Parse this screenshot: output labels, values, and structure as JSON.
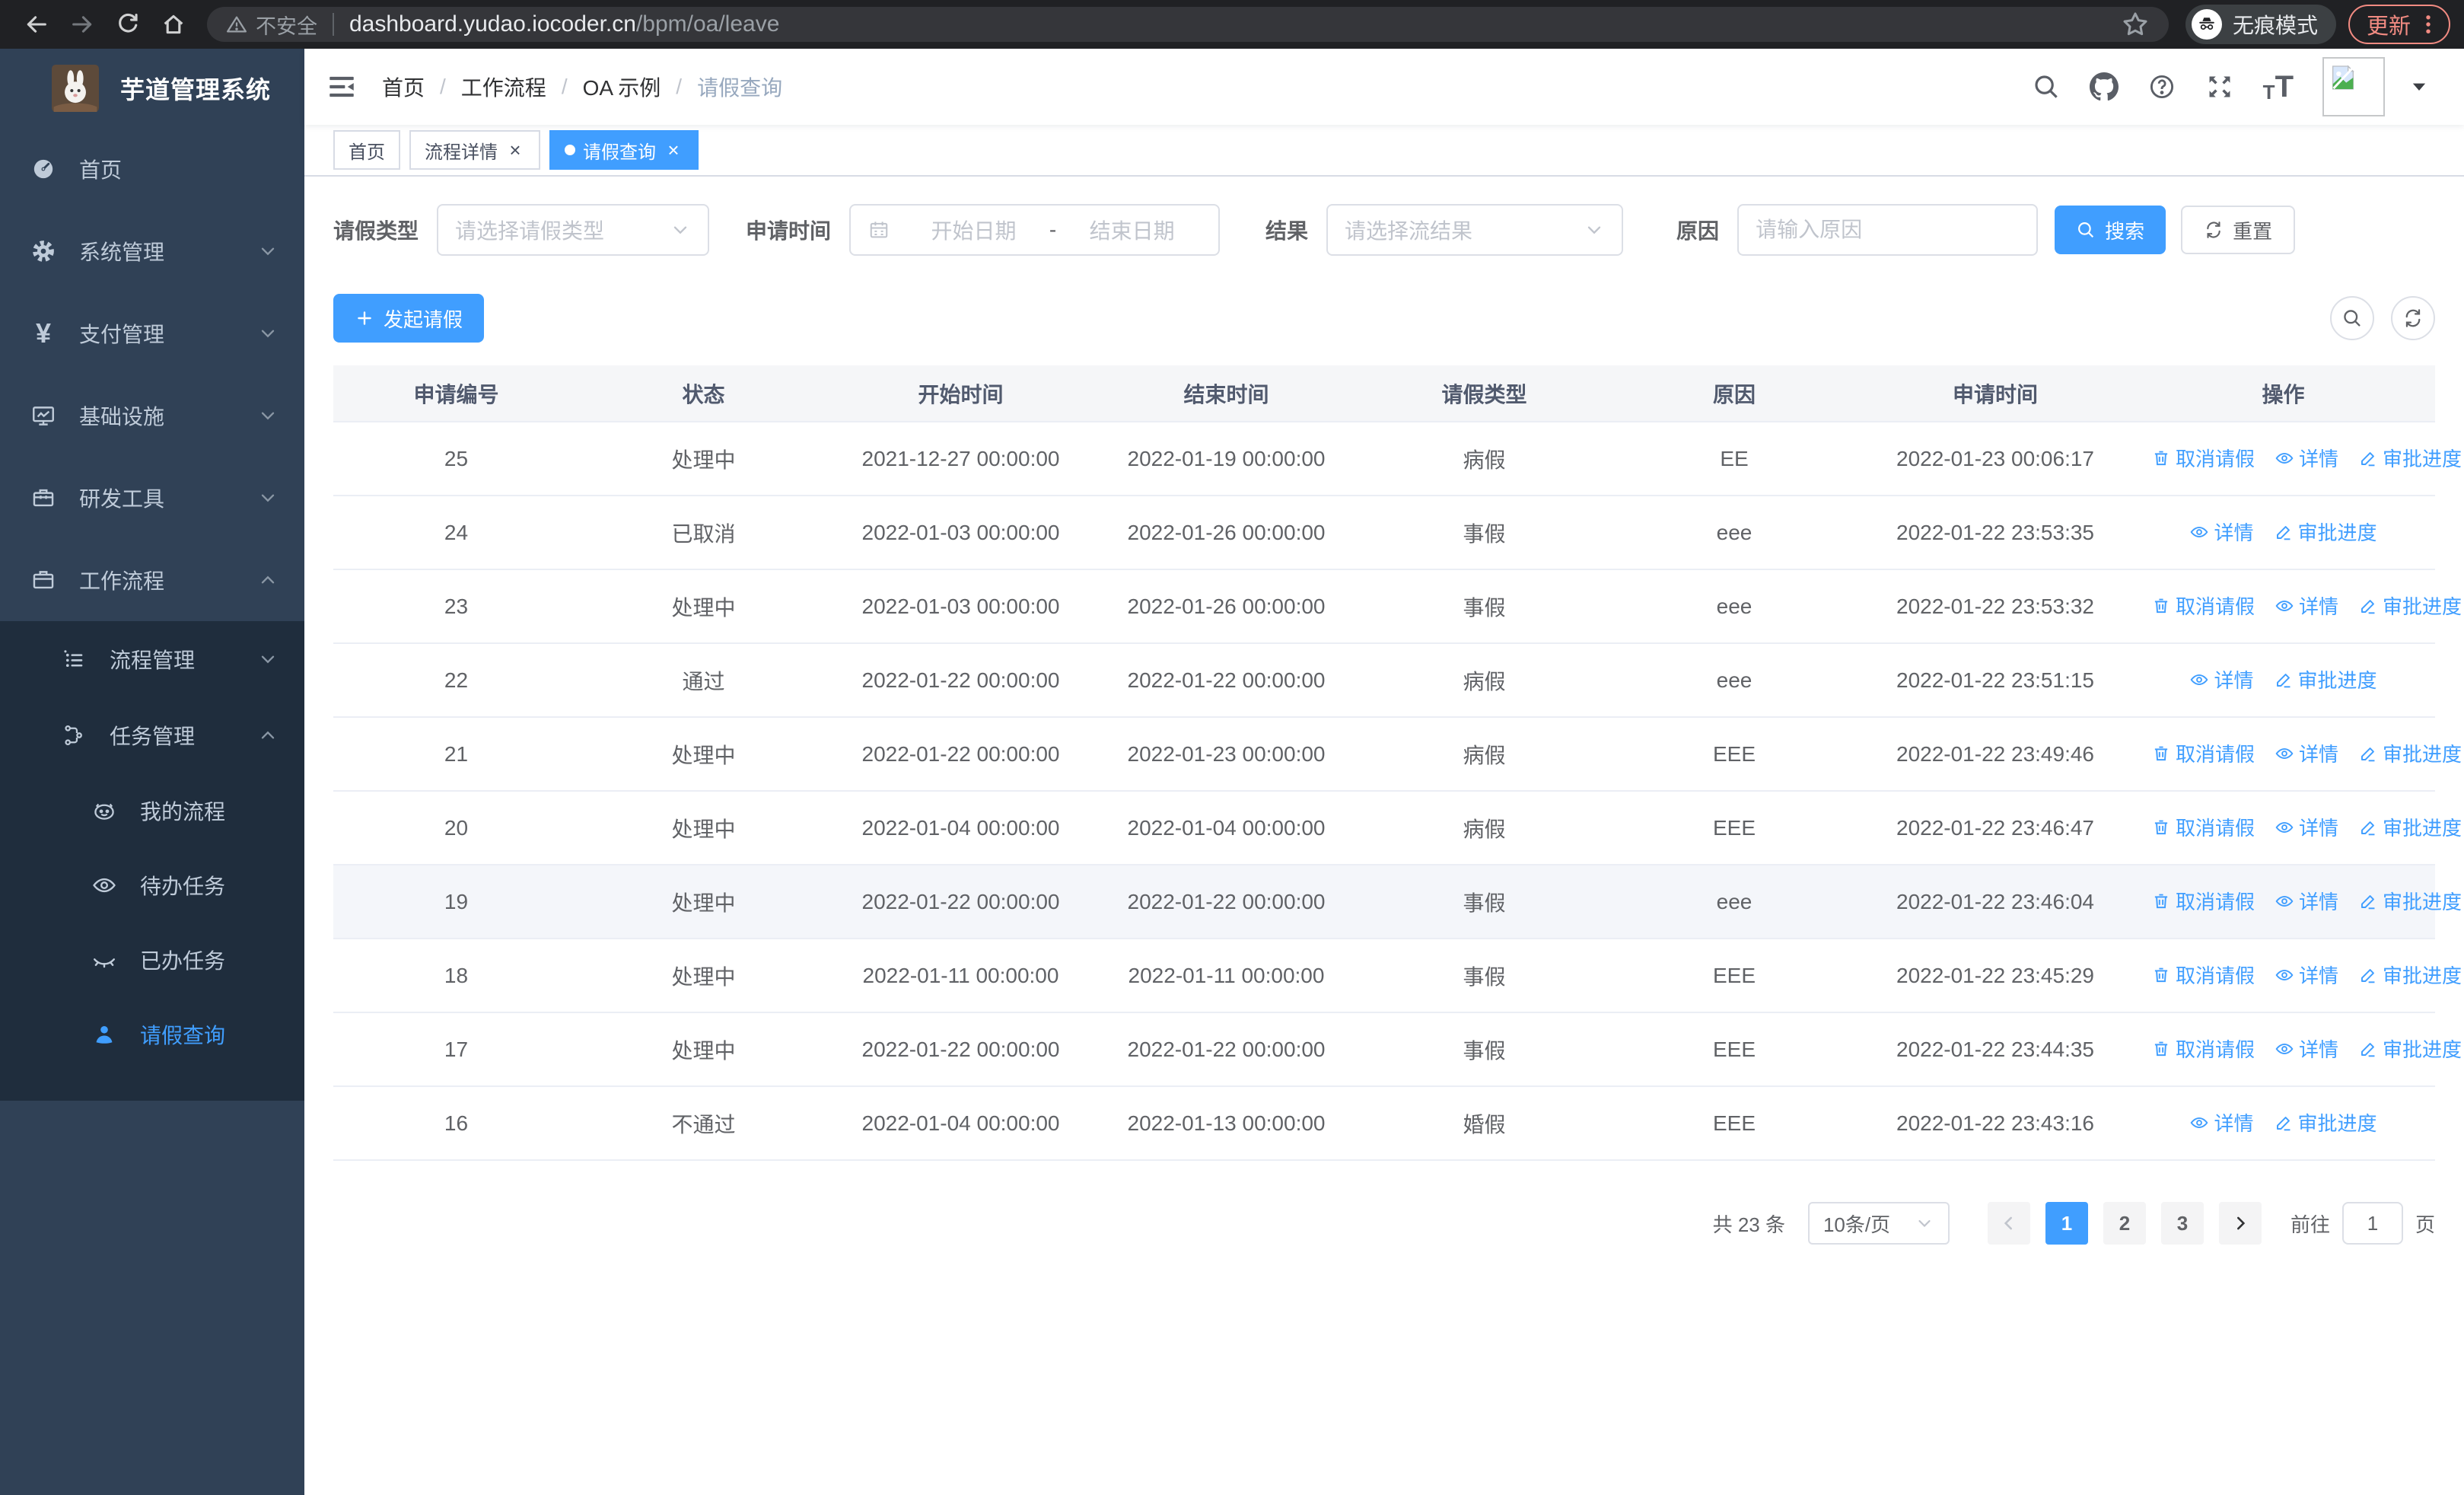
{
  "browser": {
    "security_label": "不安全",
    "url_host": "dashboard.yudao.iocoder.cn",
    "url_path": "/bpm/oa/leave",
    "incognito_label": "无痕模式",
    "update_label": "更新"
  },
  "sidebar": {
    "app_title": "芋道管理系统",
    "items": [
      {
        "key": "home",
        "label": "首页",
        "icon": "dashboard-icon",
        "level": 1
      },
      {
        "key": "system",
        "label": "系统管理",
        "icon": "gear-icon",
        "level": 1,
        "chevron": "down"
      },
      {
        "key": "payment",
        "label": "支付管理",
        "icon": "yen-icon",
        "level": 1,
        "chevron": "down"
      },
      {
        "key": "infrastructure",
        "label": "基础设施",
        "icon": "monitor-icon",
        "level": 1,
        "chevron": "down"
      },
      {
        "key": "devtools",
        "label": "研发工具",
        "icon": "toolbox-icon",
        "level": 1,
        "chevron": "down"
      },
      {
        "key": "workflow",
        "label": "工作流程",
        "icon": "briefcase-icon",
        "level": 1,
        "chevron": "up"
      },
      {
        "key": "process-management",
        "label": "流程管理",
        "icon": "list-icon",
        "level": 2,
        "chevron": "down",
        "sub": true
      },
      {
        "key": "task-management",
        "label": "任务管理",
        "icon": "org-icon",
        "level": 2,
        "chevron": "up",
        "sub": true
      },
      {
        "key": "my-process",
        "label": "我的流程",
        "icon": "face-icon",
        "level": 3,
        "sub": true
      },
      {
        "key": "todo-tasks",
        "label": "待办任务",
        "icon": "eye-open-icon",
        "level": 3,
        "sub": true
      },
      {
        "key": "done-tasks",
        "label": "已办任务",
        "icon": "eye-closed-icon",
        "level": 3,
        "sub": true
      },
      {
        "key": "leave-query",
        "label": "请假查询",
        "icon": "user-icon",
        "level": 3,
        "sub": true,
        "active": true
      }
    ]
  },
  "breadcrumb": [
    {
      "label": "首页"
    },
    {
      "label": "工作流程"
    },
    {
      "label": "OA 示例"
    },
    {
      "label": "请假查询",
      "current": true
    }
  ],
  "tabs": [
    {
      "key": "home",
      "label": "首页",
      "closable": false,
      "active": false
    },
    {
      "key": "process-detail",
      "label": "流程详情",
      "closable": true,
      "active": false
    },
    {
      "key": "leave-query",
      "label": "请假查询",
      "closable": true,
      "active": true
    }
  ],
  "filters": {
    "leave_type_label": "请假类型",
    "leave_type_placeholder": "请选择请假类型",
    "apply_time_label": "申请时间",
    "start_placeholder": "开始日期",
    "range_separator": "-",
    "end_placeholder": "结束日期",
    "result_label": "结果",
    "result_placeholder": "请选择流结果",
    "reason_label": "原因",
    "reason_placeholder": "请输入原因",
    "search_label": "搜索",
    "reset_label": "重置"
  },
  "toolbar": {
    "create_label": "发起请假"
  },
  "table": {
    "columns": [
      "申请编号",
      "状态",
      "开始时间",
      "结束时间",
      "请假类型",
      "原因",
      "申请时间",
      "操作"
    ],
    "action_labels": {
      "cancel": "取消请假",
      "detail": "详情",
      "progress": "审批进度"
    },
    "rows": [
      {
        "id": "25",
        "status": "处理中",
        "start": "2021-12-27 00:00:00",
        "end": "2022-01-19 00:00:00",
        "type": "病假",
        "reason": "EE",
        "applied": "2022-01-23 00:06:17",
        "actions": [
          "cancel",
          "detail",
          "progress"
        ]
      },
      {
        "id": "24",
        "status": "已取消",
        "start": "2022-01-03 00:00:00",
        "end": "2022-01-26 00:00:00",
        "type": "事假",
        "reason": "eee",
        "applied": "2022-01-22 23:53:35",
        "actions": [
          "detail",
          "progress"
        ]
      },
      {
        "id": "23",
        "status": "处理中",
        "start": "2022-01-03 00:00:00",
        "end": "2022-01-26 00:00:00",
        "type": "事假",
        "reason": "eee",
        "applied": "2022-01-22 23:53:32",
        "actions": [
          "cancel",
          "detail",
          "progress"
        ]
      },
      {
        "id": "22",
        "status": "通过",
        "start": "2022-01-22 00:00:00",
        "end": "2022-01-22 00:00:00",
        "type": "病假",
        "reason": "eee",
        "applied": "2022-01-22 23:51:15",
        "actions": [
          "detail",
          "progress"
        ]
      },
      {
        "id": "21",
        "status": "处理中",
        "start": "2022-01-22 00:00:00",
        "end": "2022-01-23 00:00:00",
        "type": "病假",
        "reason": "EEE",
        "applied": "2022-01-22 23:49:46",
        "actions": [
          "cancel",
          "detail",
          "progress"
        ]
      },
      {
        "id": "20",
        "status": "处理中",
        "start": "2022-01-04 00:00:00",
        "end": "2022-01-04 00:00:00",
        "type": "病假",
        "reason": "EEE",
        "applied": "2022-01-22 23:46:47",
        "actions": [
          "cancel",
          "detail",
          "progress"
        ]
      },
      {
        "id": "19",
        "status": "处理中",
        "start": "2022-01-22 00:00:00",
        "end": "2022-01-22 00:00:00",
        "type": "事假",
        "reason": "eee",
        "applied": "2022-01-22 23:46:04",
        "actions": [
          "cancel",
          "detail",
          "progress"
        ],
        "highlighted": true
      },
      {
        "id": "18",
        "status": "处理中",
        "start": "2022-01-11 00:00:00",
        "end": "2022-01-11 00:00:00",
        "type": "事假",
        "reason": "EEE",
        "applied": "2022-01-22 23:45:29",
        "actions": [
          "cancel",
          "detail",
          "progress"
        ]
      },
      {
        "id": "17",
        "status": "处理中",
        "start": "2022-01-22 00:00:00",
        "end": "2022-01-22 00:00:00",
        "type": "事假",
        "reason": "EEE",
        "applied": "2022-01-22 23:44:35",
        "actions": [
          "cancel",
          "detail",
          "progress"
        ]
      },
      {
        "id": "16",
        "status": "不通过",
        "start": "2022-01-04 00:00:00",
        "end": "2022-01-13 00:00:00",
        "type": "婚假",
        "reason": "EEE",
        "applied": "2022-01-22 23:43:16",
        "actions": [
          "detail",
          "progress"
        ]
      }
    ]
  },
  "pagination": {
    "total_label": "共 23 条",
    "page_size_label": "10条/页",
    "pages": [
      "1",
      "2",
      "3"
    ],
    "current_page": "1",
    "goto_label": "前往",
    "goto_value": "1",
    "goto_suffix": "页"
  },
  "colors": {
    "accent": "#409eff",
    "sidebar_bg": "#304156",
    "submenu_bg": "#1f2d3d",
    "link_blue": "#409eff"
  }
}
